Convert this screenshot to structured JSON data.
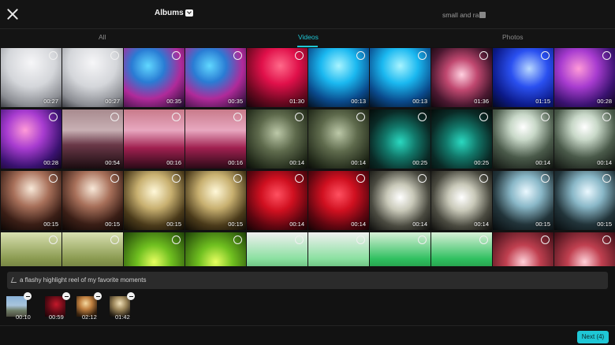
{
  "header": {
    "album_label": "Albums",
    "album_hint": "small and ra"
  },
  "tabs": [
    {
      "label": "All",
      "active": false
    },
    {
      "label": "Videos",
      "active": true
    },
    {
      "label": "Photos",
      "active": false
    }
  ],
  "accent_color": "#1fc7d6",
  "grid_items": [
    "00:27",
    "00:27",
    "00:35",
    "00:35",
    "01:30",
    "00:13",
    "00:13",
    "01:36",
    "01:15",
    "00:28",
    "00:28",
    "00:54",
    "00:16",
    "00:16",
    "00:14",
    "00:14",
    "00:25",
    "00:25",
    "00:14",
    "00:14",
    "00:15",
    "00:15",
    "00:15",
    "00:15",
    "00:14",
    "00:14",
    "00:14",
    "00:14",
    "00:15",
    "00:15",
    "",
    "",
    "",
    "",
    "",
    "",
    "",
    "",
    "",
    ""
  ],
  "prompt": {
    "text": "a flashy highlight reel of my favorite moments"
  },
  "selected": [
    {
      "duration": "00:10"
    },
    {
      "duration": "00:59"
    },
    {
      "duration": "02:12"
    },
    {
      "duration": "01:42"
    }
  ],
  "next_label": "Next (4)"
}
